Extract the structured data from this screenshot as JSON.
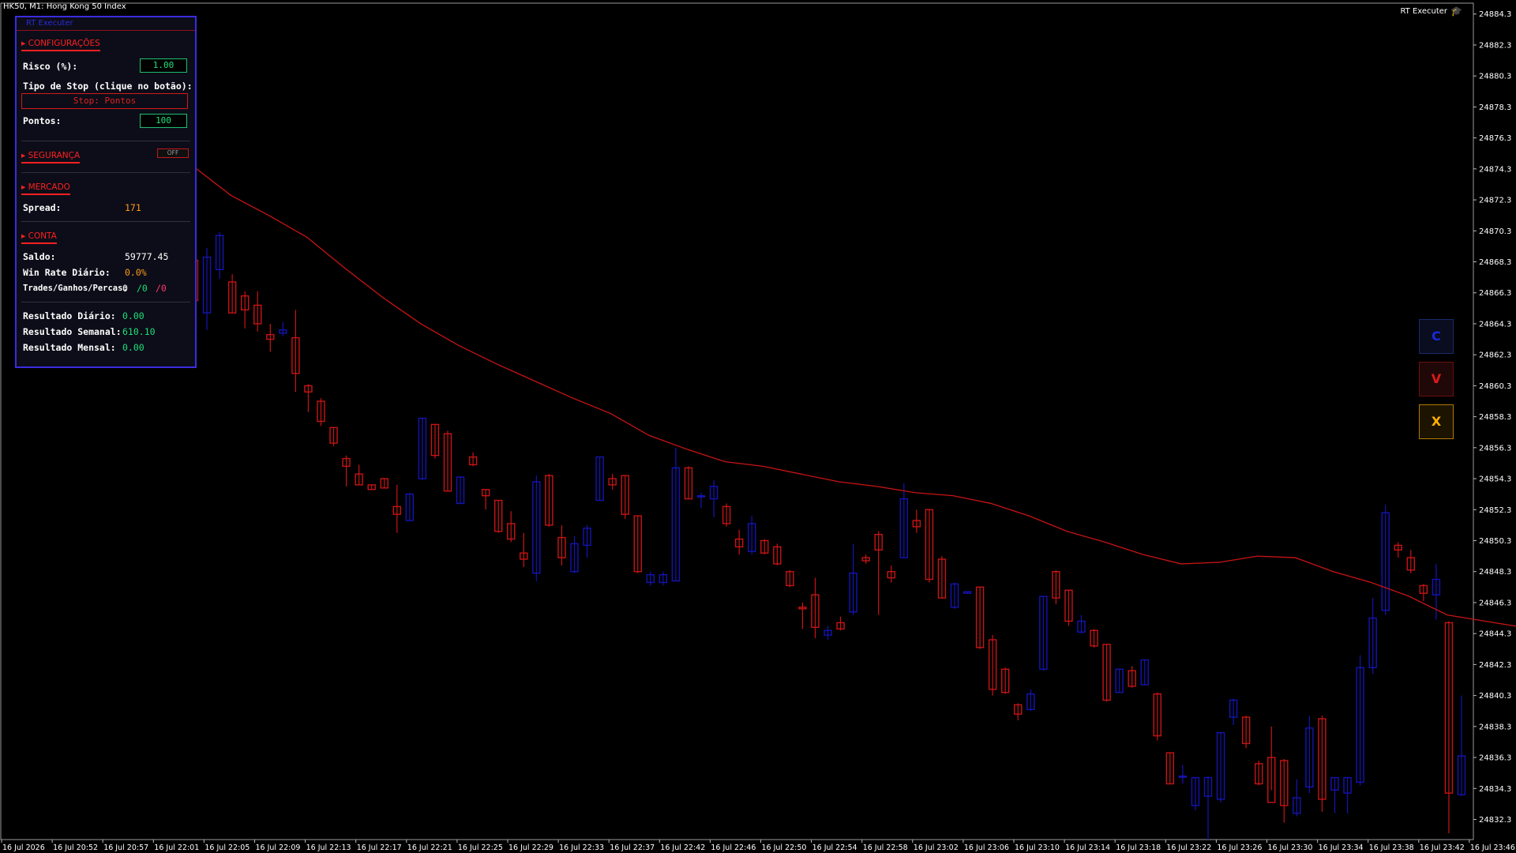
{
  "chart": {
    "title": "HK50, M1:  Hong Kong 50 Index",
    "ea_name": "RT Executer",
    "ea_icon": "graduation-cap-icon",
    "colors": {
      "background": "#000000",
      "bull_candle": "#1414b4",
      "bear_candle": "#c81414",
      "moving_average": "#c81414",
      "axis_text": "#ffffff"
    }
  },
  "panel": {
    "header": "RT Executer",
    "sections": {
      "config": "▸ CONFIGURAÇÕES",
      "security": "▸ SEGURANÇA",
      "market": "▸ MERCADO",
      "account": "▸ CONTA"
    },
    "risk_label": "Risco (%):",
    "risk_value": "1.00",
    "stop_type_label": "Tipo de Stop (clique no botão):",
    "stop_button": "Stop: Pontos",
    "points_label": "Pontos:",
    "points_value": "100",
    "security_toggle": "OFF",
    "spread_label": "Spread:",
    "spread_value": "171",
    "balance_label": "Saldo:",
    "balance_value": "59777.45",
    "winrate_label": "Win Rate Diário:",
    "winrate_value": "0.0%",
    "trades_label": "Trades/Ganhos/Percas:",
    "trades_value": "0",
    "wins_value": "/0",
    "losses_value": "/0",
    "daily_label": "Resultado Diário:",
    "daily_value": "0.00",
    "weekly_label": "Resultado Semanal:",
    "weekly_value": "610.10",
    "monthly_label": "Resultado Mensal:",
    "monthly_value": "0.00",
    "colors": {
      "value_green": "#1ee07a",
      "value_orange": "#ff9a1a",
      "value_white": "#ffffff",
      "losses_pink": "#ff3a6a",
      "section_red": "#ff2020",
      "border_blue": "#3a2ce0"
    }
  },
  "side_buttons": {
    "close": {
      "label": "C",
      "color": "#1a2adc",
      "border": "#1a2a6a",
      "bg": "#0a0d20"
    },
    "sell": {
      "label": "V",
      "color": "#e01a1a",
      "border": "#6a1010",
      "bg": "#200808"
    },
    "cancel": {
      "label": "X",
      "color": "#ffb000",
      "border": "#b07a00",
      "bg": "#1c1400"
    }
  },
  "price_axis": [
    "24884.3",
    "24882.3",
    "24880.3",
    "24878.3",
    "24876.3",
    "24874.3",
    "24872.3",
    "24870.3",
    "24868.3",
    "24866.3",
    "24864.3",
    "24862.3",
    "24860.3",
    "24858.3",
    "24856.3",
    "24854.3",
    "24852.3",
    "24850.3",
    "24848.3",
    "24846.3",
    "24844.3",
    "24842.3",
    "24840.3",
    "24838.3",
    "24836.3",
    "24834.3",
    "24832.3"
  ],
  "time_axis": [
    "16 Jul 2026",
    "16 Jul 20:52",
    "16 Jul 20:57",
    "16 Jul 22:01",
    "16 Jul 22:05",
    "16 Jul 22:09",
    "16 Jul 22:13",
    "16 Jul 22:17",
    "16 Jul 22:21",
    "16 Jul 22:25",
    "16 Jul 22:29",
    "16 Jul 22:33",
    "16 Jul 22:37",
    "16 Jul 22:42",
    "16 Jul 22:46",
    "16 Jul 22:50",
    "16 Jul 22:54",
    "16 Jul 22:58",
    "16 Jul 23:02",
    "16 Jul 23:06",
    "16 Jul 23:10",
    "16 Jul 23:14",
    "16 Jul 23:18",
    "16 Jul 23:22",
    "16 Jul 23:26",
    "16 Jul 23:30",
    "16 Jul 23:34",
    "16 Jul 23:38",
    "16 Jul 23:42",
    "16 Jul 23:46"
  ],
  "chart_data": {
    "type": "candlestick",
    "ylim": [
      24831.0,
      24885.0
    ],
    "candles": [
      {
        "o": 24868.4,
        "h": 24869.6,
        "l": 24864.6,
        "c": 24865.8
      },
      {
        "o": 24865.0,
        "h": 24869.2,
        "l": 24863.9,
        "c": 24868.6
      },
      {
        "o": 24867.8,
        "h": 24870.2,
        "l": 24867.2,
        "c": 24870.0
      },
      {
        "o": 24867.0,
        "h": 24867.5,
        "l": 24865.0,
        "c": 24865.0
      },
      {
        "o": 24866.1,
        "h": 24866.4,
        "l": 24864.0,
        "c": 24865.2
      },
      {
        "o": 24865.5,
        "h": 24866.4,
        "l": 24863.8,
        "c": 24864.3
      },
      {
        "o": 24863.6,
        "h": 24864.3,
        "l": 24862.5,
        "c": 24863.3
      },
      {
        "o": 24863.7,
        "h": 24864.4,
        "l": 24863.5,
        "c": 24863.9
      },
      {
        "o": 24863.4,
        "h": 24865.2,
        "l": 24859.9,
        "c": 24861.1
      },
      {
        "o": 24860.3,
        "h": 24860.4,
        "l": 24858.6,
        "c": 24859.9
      },
      {
        "o": 24859.3,
        "h": 24859.5,
        "l": 24857.7,
        "c": 24858.0
      },
      {
        "o": 24857.6,
        "h": 24857.6,
        "l": 24856.4,
        "c": 24856.6
      },
      {
        "o": 24855.6,
        "h": 24855.8,
        "l": 24853.8,
        "c": 24855.1
      },
      {
        "o": 24854.6,
        "h": 24855.2,
        "l": 24853.9,
        "c": 24853.9
      },
      {
        "o": 24853.9,
        "h": 24853.9,
        "l": 24853.6,
        "c": 24853.6
      },
      {
        "o": 24854.3,
        "h": 24854.3,
        "l": 24853.7,
        "c": 24853.7
      },
      {
        "o": 24852.5,
        "h": 24853.9,
        "l": 24850.8,
        "c": 24852.0
      },
      {
        "o": 24851.6,
        "h": 24853.4,
        "l": 24851.6,
        "c": 24853.3
      },
      {
        "o": 24854.3,
        "h": 24858.2,
        "l": 24854.2,
        "c": 24858.2
      },
      {
        "o": 24857.8,
        "h": 24857.8,
        "l": 24855.6,
        "c": 24855.8
      },
      {
        "o": 24857.2,
        "h": 24857.4,
        "l": 24853.5,
        "c": 24853.5
      },
      {
        "o": 24852.7,
        "h": 24854.4,
        "l": 24852.7,
        "c": 24854.4
      },
      {
        "o": 24855.7,
        "h": 24856.0,
        "l": 24855.1,
        "c": 24855.2
      },
      {
        "o": 24853.6,
        "h": 24853.6,
        "l": 24852.3,
        "c": 24853.2
      },
      {
        "o": 24852.9,
        "h": 24852.9,
        "l": 24850.8,
        "c": 24850.9
      },
      {
        "o": 24851.4,
        "h": 24852.2,
        "l": 24850.2,
        "c": 24850.4
      },
      {
        "o": 24849.5,
        "h": 24850.8,
        "l": 24848.6,
        "c": 24849.1
      },
      {
        "o": 24848.2,
        "h": 24854.5,
        "l": 24847.7,
        "c": 24854.1
      },
      {
        "o": 24854.5,
        "h": 24854.6,
        "l": 24851.2,
        "c": 24851.3
      },
      {
        "o": 24850.5,
        "h": 24851.3,
        "l": 24848.7,
        "c": 24849.2
      },
      {
        "o": 24848.3,
        "h": 24850.6,
        "l": 24848.2,
        "c": 24850.1
      },
      {
        "o": 24850.0,
        "h": 24851.3,
        "l": 24849.2,
        "c": 24851.1
      },
      {
        "o": 24852.9,
        "h": 24855.7,
        "l": 24852.9,
        "c": 24855.7
      },
      {
        "o": 24854.3,
        "h": 24854.6,
        "l": 24853.6,
        "c": 24853.9
      },
      {
        "o": 24854.5,
        "h": 24854.5,
        "l": 24851.7,
        "c": 24852.0
      },
      {
        "o": 24851.9,
        "h": 24851.9,
        "l": 24848.2,
        "c": 24848.3
      },
      {
        "o": 24847.6,
        "h": 24848.3,
        "l": 24847.4,
        "c": 24848.1
      },
      {
        "o": 24847.6,
        "h": 24848.3,
        "l": 24847.4,
        "c": 24848.1
      },
      {
        "o": 24847.7,
        "h": 24856.3,
        "l": 24847.7,
        "c": 24855.0
      },
      {
        "o": 24855.0,
        "h": 24855.1,
        "l": 24853.0,
        "c": 24853.0
      },
      {
        "o": 24853.2,
        "h": 24853.4,
        "l": 24852.4,
        "c": 24853.2
      },
      {
        "o": 24853.0,
        "h": 24854.2,
        "l": 24851.8,
        "c": 24853.8
      },
      {
        "o": 24852.5,
        "h": 24852.7,
        "l": 24851.2,
        "c": 24851.4
      },
      {
        "o": 24850.4,
        "h": 24851.0,
        "l": 24849.4,
        "c": 24849.9
      },
      {
        "o": 24849.6,
        "h": 24851.9,
        "l": 24849.4,
        "c": 24851.4
      },
      {
        "o": 24850.3,
        "h": 24850.4,
        "l": 24849.4,
        "c": 24849.5
      },
      {
        "o": 24849.9,
        "h": 24850.1,
        "l": 24848.7,
        "c": 24848.8
      },
      {
        "o": 24848.3,
        "h": 24848.4,
        "l": 24847.3,
        "c": 24847.4
      },
      {
        "o": 24846.0,
        "h": 24846.3,
        "l": 24844.6,
        "c": 24845.9
      },
      {
        "o": 24846.8,
        "h": 24847.9,
        "l": 24844.0,
        "c": 24844.7
      },
      {
        "o": 24844.2,
        "h": 24844.8,
        "l": 24843.9,
        "c": 24844.5
      },
      {
        "o": 24845.0,
        "h": 24845.4,
        "l": 24844.5,
        "c": 24844.6
      },
      {
        "o": 24845.7,
        "h": 24850.1,
        "l": 24845.5,
        "c": 24848.2
      },
      {
        "o": 24849.2,
        "h": 24849.4,
        "l": 24848.8,
        "c": 24849.0
      },
      {
        "o": 24850.7,
        "h": 24850.9,
        "l": 24845.5,
        "c": 24849.7
      },
      {
        "o": 24848.3,
        "h": 24848.7,
        "l": 24847.6,
        "c": 24847.9
      },
      {
        "o": 24849.2,
        "h": 24854.0,
        "l": 24849.2,
        "c": 24853.0
      },
      {
        "o": 24851.6,
        "h": 24852.3,
        "l": 24850.8,
        "c": 24851.2
      },
      {
        "o": 24852.3,
        "h": 24852.3,
        "l": 24847.6,
        "c": 24847.8
      },
      {
        "o": 24849.1,
        "h": 24849.3,
        "l": 24846.6,
        "c": 24846.6
      },
      {
        "o": 24846.0,
        "h": 24847.6,
        "l": 24845.9,
        "c": 24847.5
      },
      {
        "o": 24846.9,
        "h": 24847.0,
        "l": 24846.9,
        "c": 24847.0
      },
      {
        "o": 24847.3,
        "h": 24847.3,
        "l": 24843.3,
        "c": 24843.4
      },
      {
        "o": 24843.9,
        "h": 24844.2,
        "l": 24840.3,
        "c": 24840.7
      },
      {
        "o": 24842.0,
        "h": 24842.1,
        "l": 24840.4,
        "c": 24840.5
      },
      {
        "o": 24839.7,
        "h": 24839.8,
        "l": 24838.7,
        "c": 24839.1
      },
      {
        "o": 24839.4,
        "h": 24840.7,
        "l": 24839.3,
        "c": 24840.4
      },
      {
        "o": 24842.0,
        "h": 24846.7,
        "l": 24841.9,
        "c": 24846.7
      },
      {
        "o": 24848.3,
        "h": 24848.4,
        "l": 24846.2,
        "c": 24846.6
      },
      {
        "o": 24847.1,
        "h": 24847.1,
        "l": 24844.8,
        "c": 24845.1
      },
      {
        "o": 24844.4,
        "h": 24845.5,
        "l": 24844.3,
        "c": 24845.1
      },
      {
        "o": 24844.5,
        "h": 24844.6,
        "l": 24843.4,
        "c": 24843.5
      },
      {
        "o": 24843.6,
        "h": 24843.6,
        "l": 24839.9,
        "c": 24840.0
      },
      {
        "o": 24840.5,
        "h": 24842.0,
        "l": 24840.5,
        "c": 24842.0
      },
      {
        "o": 24841.9,
        "h": 24842.2,
        "l": 24840.8,
        "c": 24840.9
      },
      {
        "o": 24841.0,
        "h": 24842.6,
        "l": 24841.0,
        "c": 24842.6
      },
      {
        "o": 24840.4,
        "h": 24840.5,
        "l": 24837.4,
        "c": 24837.7
      },
      {
        "o": 24836.6,
        "h": 24836.6,
        "l": 24834.6,
        "c": 24834.6
      },
      {
        "o": 24835.1,
        "h": 24835.8,
        "l": 24834.6,
        "c": 24835.1
      },
      {
        "o": 24833.2,
        "h": 24835.0,
        "l": 24832.9,
        "c": 24835.0
      },
      {
        "o": 24833.8,
        "h": 24835.1,
        "l": 24831.0,
        "c": 24835.0
      },
      {
        "o": 24833.6,
        "h": 24837.9,
        "l": 24833.4,
        "c": 24837.9
      },
      {
        "o": 24838.9,
        "h": 24840.1,
        "l": 24838.4,
        "c": 24840.0
      },
      {
        "o": 24838.9,
        "h": 24839.0,
        "l": 24836.9,
        "c": 24837.2
      },
      {
        "o": 24835.9,
        "h": 24836.1,
        "l": 24834.5,
        "c": 24834.6
      },
      {
        "o": 24836.3,
        "h": 24838.3,
        "l": 24834.2,
        "c": 24833.4
      },
      {
        "o": 24836.1,
        "h": 24836.2,
        "l": 24832.1,
        "c": 24833.2
      },
      {
        "o": 24832.7,
        "h": 24834.9,
        "l": 24832.5,
        "c": 24833.7
      },
      {
        "o": 24834.4,
        "h": 24839.0,
        "l": 24834.0,
        "c": 24838.2
      },
      {
        "o": 24838.8,
        "h": 24839.0,
        "l": 24832.8,
        "c": 24833.6
      },
      {
        "o": 24834.2,
        "h": 24835.0,
        "l": 24832.7,
        "c": 24835.0
      },
      {
        "o": 24834.0,
        "h": 24835.0,
        "l": 24832.7,
        "c": 24835.0
      },
      {
        "o": 24834.7,
        "h": 24842.9,
        "l": 24834.5,
        "c": 24842.1
      },
      {
        "o": 24842.1,
        "h": 24846.6,
        "l": 24841.7,
        "c": 24845.3
      },
      {
        "o": 24845.8,
        "h": 24852.6,
        "l": 24845.5,
        "c": 24852.1
      },
      {
        "o": 24850.0,
        "h": 24850.2,
        "l": 24849.2,
        "c": 24849.7
      },
      {
        "o": 24849.2,
        "h": 24849.7,
        "l": 24848.2,
        "c": 24848.4
      },
      {
        "o": 24847.4,
        "h": 24847.5,
        "l": 24846.4,
        "c": 24846.9
      },
      {
        "o": 24846.8,
        "h": 24848.8,
        "l": 24845.2,
        "c": 24847.8
      },
      {
        "o": 24845.0,
        "h": 24845.1,
        "l": 24831.4,
        "c": 24834.0
      },
      {
        "o": 24833.9,
        "h": 24840.3,
        "l": 24833.8,
        "c": 24836.4
      }
    ],
    "ma_points": [
      [
        0,
        24874.5
      ],
      [
        3,
        24872.6
      ],
      [
        6,
        24871.3
      ],
      [
        9,
        24869.9
      ],
      [
        12,
        24867.9
      ],
      [
        15,
        24866.0
      ],
      [
        18,
        24864.3
      ],
      [
        21,
        24862.9
      ],
      [
        24,
        24861.7
      ],
      [
        27,
        24860.6
      ],
      [
        30,
        24859.5
      ],
      [
        33,
        24858.5
      ],
      [
        36,
        24857.1
      ],
      [
        39,
        24856.2
      ],
      [
        42,
        24855.4
      ],
      [
        45,
        24855.1
      ],
      [
        48,
        24854.6
      ],
      [
        51,
        24854.1
      ],
      [
        54,
        24853.8
      ],
      [
        57,
        24853.4
      ],
      [
        60,
        24853.2
      ],
      [
        63,
        24852.7
      ],
      [
        66,
        24851.9
      ],
      [
        69,
        24850.9
      ],
      [
        72,
        24850.2
      ],
      [
        75,
        24849.4
      ],
      [
        78,
        24848.8
      ],
      [
        81,
        24848.9
      ],
      [
        84,
        24849.3
      ],
      [
        87,
        24849.2
      ],
      [
        90,
        24848.3
      ],
      [
        93,
        24847.6
      ],
      [
        96,
        24846.7
      ],
      [
        99,
        24845.5
      ],
      [
        102,
        24845.1
      ],
      [
        105,
        24844.7
      ],
      [
        108,
        24844.3
      ],
      [
        111,
        24843.5
      ],
      [
        114,
        24842.3
      ],
      [
        117,
        24841.2
      ],
      [
        120,
        24840.5
      ],
      [
        123,
        24840.0
      ],
      [
        126,
        24839.0
      ],
      [
        129,
        24837.6
      ],
      [
        132,
        24837.3
      ],
      [
        135,
        24837.6
      ],
      [
        138,
        24839.7
      ],
      [
        141,
        24841.3
      ],
      [
        144,
        24842.5
      ],
      [
        147,
        24841.6
      ],
      [
        150,
        24841.3
      ]
    ]
  }
}
